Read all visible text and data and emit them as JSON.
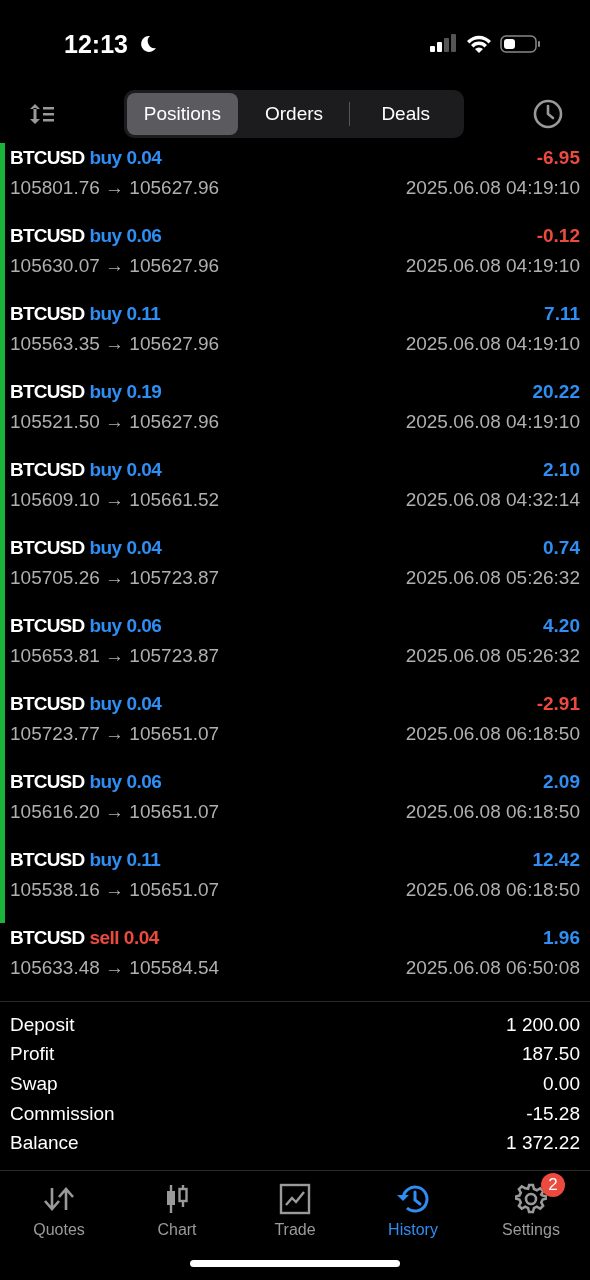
{
  "status_bar": {
    "time": "12:13"
  },
  "tabs": [
    {
      "label": "Positions",
      "selected": true
    },
    {
      "label": "Orders",
      "selected": false
    },
    {
      "label": "Deals",
      "selected": false
    }
  ],
  "deals": [
    {
      "symbol": "BTCUSD",
      "side": "buy",
      "volume": "0.04",
      "prices": "105801.76 → 105627.96",
      "time": "2025.06.08 04:19:10",
      "profit": "-6.95",
      "loss": true,
      "marked": true
    },
    {
      "symbol": "BTCUSD",
      "side": "buy",
      "volume": "0.06",
      "prices": "105630.07 → 105627.96",
      "time": "2025.06.08 04:19:10",
      "profit": "-0.12",
      "loss": true,
      "marked": true
    },
    {
      "symbol": "BTCUSD",
      "side": "buy",
      "volume": "0.11",
      "prices": "105563.35 → 105627.96",
      "time": "2025.06.08 04:19:10",
      "profit": "7.11",
      "loss": false,
      "marked": true
    },
    {
      "symbol": "BTCUSD",
      "side": "buy",
      "volume": "0.19",
      "prices": "105521.50 → 105627.96",
      "time": "2025.06.08 04:19:10",
      "profit": "20.22",
      "loss": false,
      "marked": true
    },
    {
      "symbol": "BTCUSD",
      "side": "buy",
      "volume": "0.04",
      "prices": "105609.10 → 105661.52",
      "time": "2025.06.08 04:32:14",
      "profit": "2.10",
      "loss": false,
      "marked": true
    },
    {
      "symbol": "BTCUSD",
      "side": "buy",
      "volume": "0.04",
      "prices": "105705.26 → 105723.87",
      "time": "2025.06.08 05:26:32",
      "profit": "0.74",
      "loss": false,
      "marked": true
    },
    {
      "symbol": "BTCUSD",
      "side": "buy",
      "volume": "0.06",
      "prices": "105653.81 → 105723.87",
      "time": "2025.06.08 05:26:32",
      "profit": "4.20",
      "loss": false,
      "marked": true
    },
    {
      "symbol": "BTCUSD",
      "side": "buy",
      "volume": "0.04",
      "prices": "105723.77 → 105651.07",
      "time": "2025.06.08 06:18:50",
      "profit": "-2.91",
      "loss": true,
      "marked": true
    },
    {
      "symbol": "BTCUSD",
      "side": "buy",
      "volume": "0.06",
      "prices": "105616.20 → 105651.07",
      "time": "2025.06.08 06:18:50",
      "profit": "2.09",
      "loss": false,
      "marked": true
    },
    {
      "symbol": "BTCUSD",
      "side": "buy",
      "volume": "0.11",
      "prices": "105538.16 → 105651.07",
      "time": "2025.06.08 06:18:50",
      "profit": "12.42",
      "loss": false,
      "marked": true
    },
    {
      "symbol": "BTCUSD",
      "side": "sell",
      "volume": "0.04",
      "prices": "105633.48 → 105584.54",
      "time": "2025.06.08 06:50:08",
      "profit": "1.96",
      "loss": false,
      "marked": false
    }
  ],
  "summary": [
    {
      "label": "Deposit",
      "value": "1 200.00"
    },
    {
      "label": "Profit",
      "value": "187.50"
    },
    {
      "label": "Swap",
      "value": "0.00"
    },
    {
      "label": "Commission",
      "value": "-15.28"
    },
    {
      "label": "Balance",
      "value": "1 372.22"
    }
  ],
  "nav": [
    {
      "kind": "quotes",
      "label": "Quotes",
      "selected": false
    },
    {
      "kind": "chart",
      "label": "Chart",
      "selected": false
    },
    {
      "kind": "trade",
      "label": "Trade",
      "selected": false
    },
    {
      "kind": "history",
      "label": "History",
      "selected": true
    },
    {
      "kind": "settings",
      "label": "Settings",
      "selected": false,
      "badge": "2"
    }
  ]
}
